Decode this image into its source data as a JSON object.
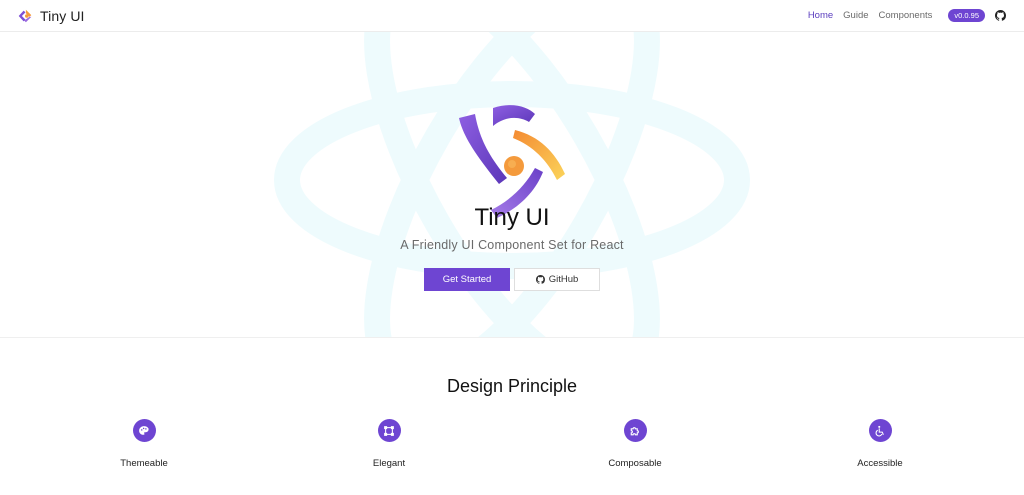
{
  "header": {
    "brand_name": "Tiny UI",
    "nav": [
      {
        "label": "Home",
        "active": true
      },
      {
        "label": "Guide",
        "active": false
      },
      {
        "label": "Components",
        "active": false
      }
    ],
    "version": "v0.0.95",
    "icons": [
      "tiny-ui-logo-icon",
      "github-icon"
    ]
  },
  "hero": {
    "title": "Tiny UI",
    "subtitle": "A Friendly UI Component Set for React",
    "primary_button": "Get Started",
    "secondary_button": "GitHub",
    "background_icon": "react-atom-icon"
  },
  "principles": {
    "title": "Design Principle",
    "items": [
      {
        "label": "Themeable",
        "icon": "palette-icon"
      },
      {
        "label": "Elegant",
        "icon": "vector-square-icon"
      },
      {
        "label": "Composable",
        "icon": "puzzle-icon"
      },
      {
        "label": "Accessible",
        "icon": "wheelchair-icon"
      }
    ]
  },
  "colors": {
    "accent": "#6e45d2",
    "logo_orange": "#f7a23b",
    "hero_watermark": "#eefbfd"
  }
}
